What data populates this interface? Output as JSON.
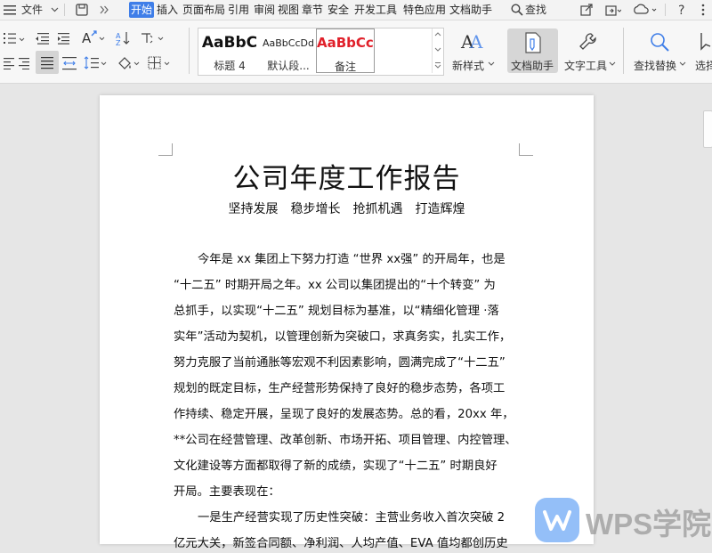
{
  "menu": {
    "file_label": "文件",
    "tabs": [
      "开始",
      "插入",
      "页面布局",
      "引用",
      "审阅",
      "视图",
      "章节",
      "安全",
      "开发工具",
      "特色应用",
      "文档助手"
    ],
    "active_tab": "开始",
    "search_label": "查找"
  },
  "ribbon": {
    "styles": [
      {
        "sample": "AaBbC",
        "name": "标题 4"
      },
      {
        "sample": "AaBbCcDd",
        "name": "默认段..."
      },
      {
        "sample": "AaBbCcI",
        "name": "备注"
      }
    ],
    "new_style_label": "新样式",
    "doc_assistant_label": "文档助手",
    "text_tools_label": "文字工具",
    "find_replace_label": "查找替换",
    "select_label": "选择"
  },
  "document": {
    "title": "公司年度工作报告",
    "subtitle": "坚持发展　稳步增长　抢抓机遇　打造辉煌",
    "lines": [
      "今年是 xx 集团上下努力打造 “世界 xx强” 的开局年，也是",
      "“十二五” 时期开局之年。xx 公司以集团提出的“十个转变” 为",
      "总抓手，以实现“十二五” 规划目标为基准，以“精细化管理 ·落",
      "实年”活动为契机，以管理创新为突破口，求真务实，扎实工作，",
      "努力克服了当前通胀等宏观不利因素影响，圆满完成了“十二五”",
      "规划的既定目标，生产经营形势保持了良好的稳步态势，各项工",
      "作持续、稳定开展，呈现了良好的发展态势。总的看，20xx 年，",
      "**公司在经营管理、改革创新、市场开拓、项目管理、内控管理、",
      "文化建设等方面都取得了新的成绩，实现了“十二五” 时期良好",
      "开局。主要表现在：",
      "一是生产经营实现了历史性突破：主营业务收入首次突破 2",
      "亿元大关，新签合同额、净利润、人均产值、EVA 值均都创历史"
    ]
  },
  "watermark": {
    "text": "WPS学院"
  },
  "colors": {
    "accent": "#3f7ee8",
    "style_red": "#e0202a",
    "wps_blue": "#3d8bf2"
  }
}
